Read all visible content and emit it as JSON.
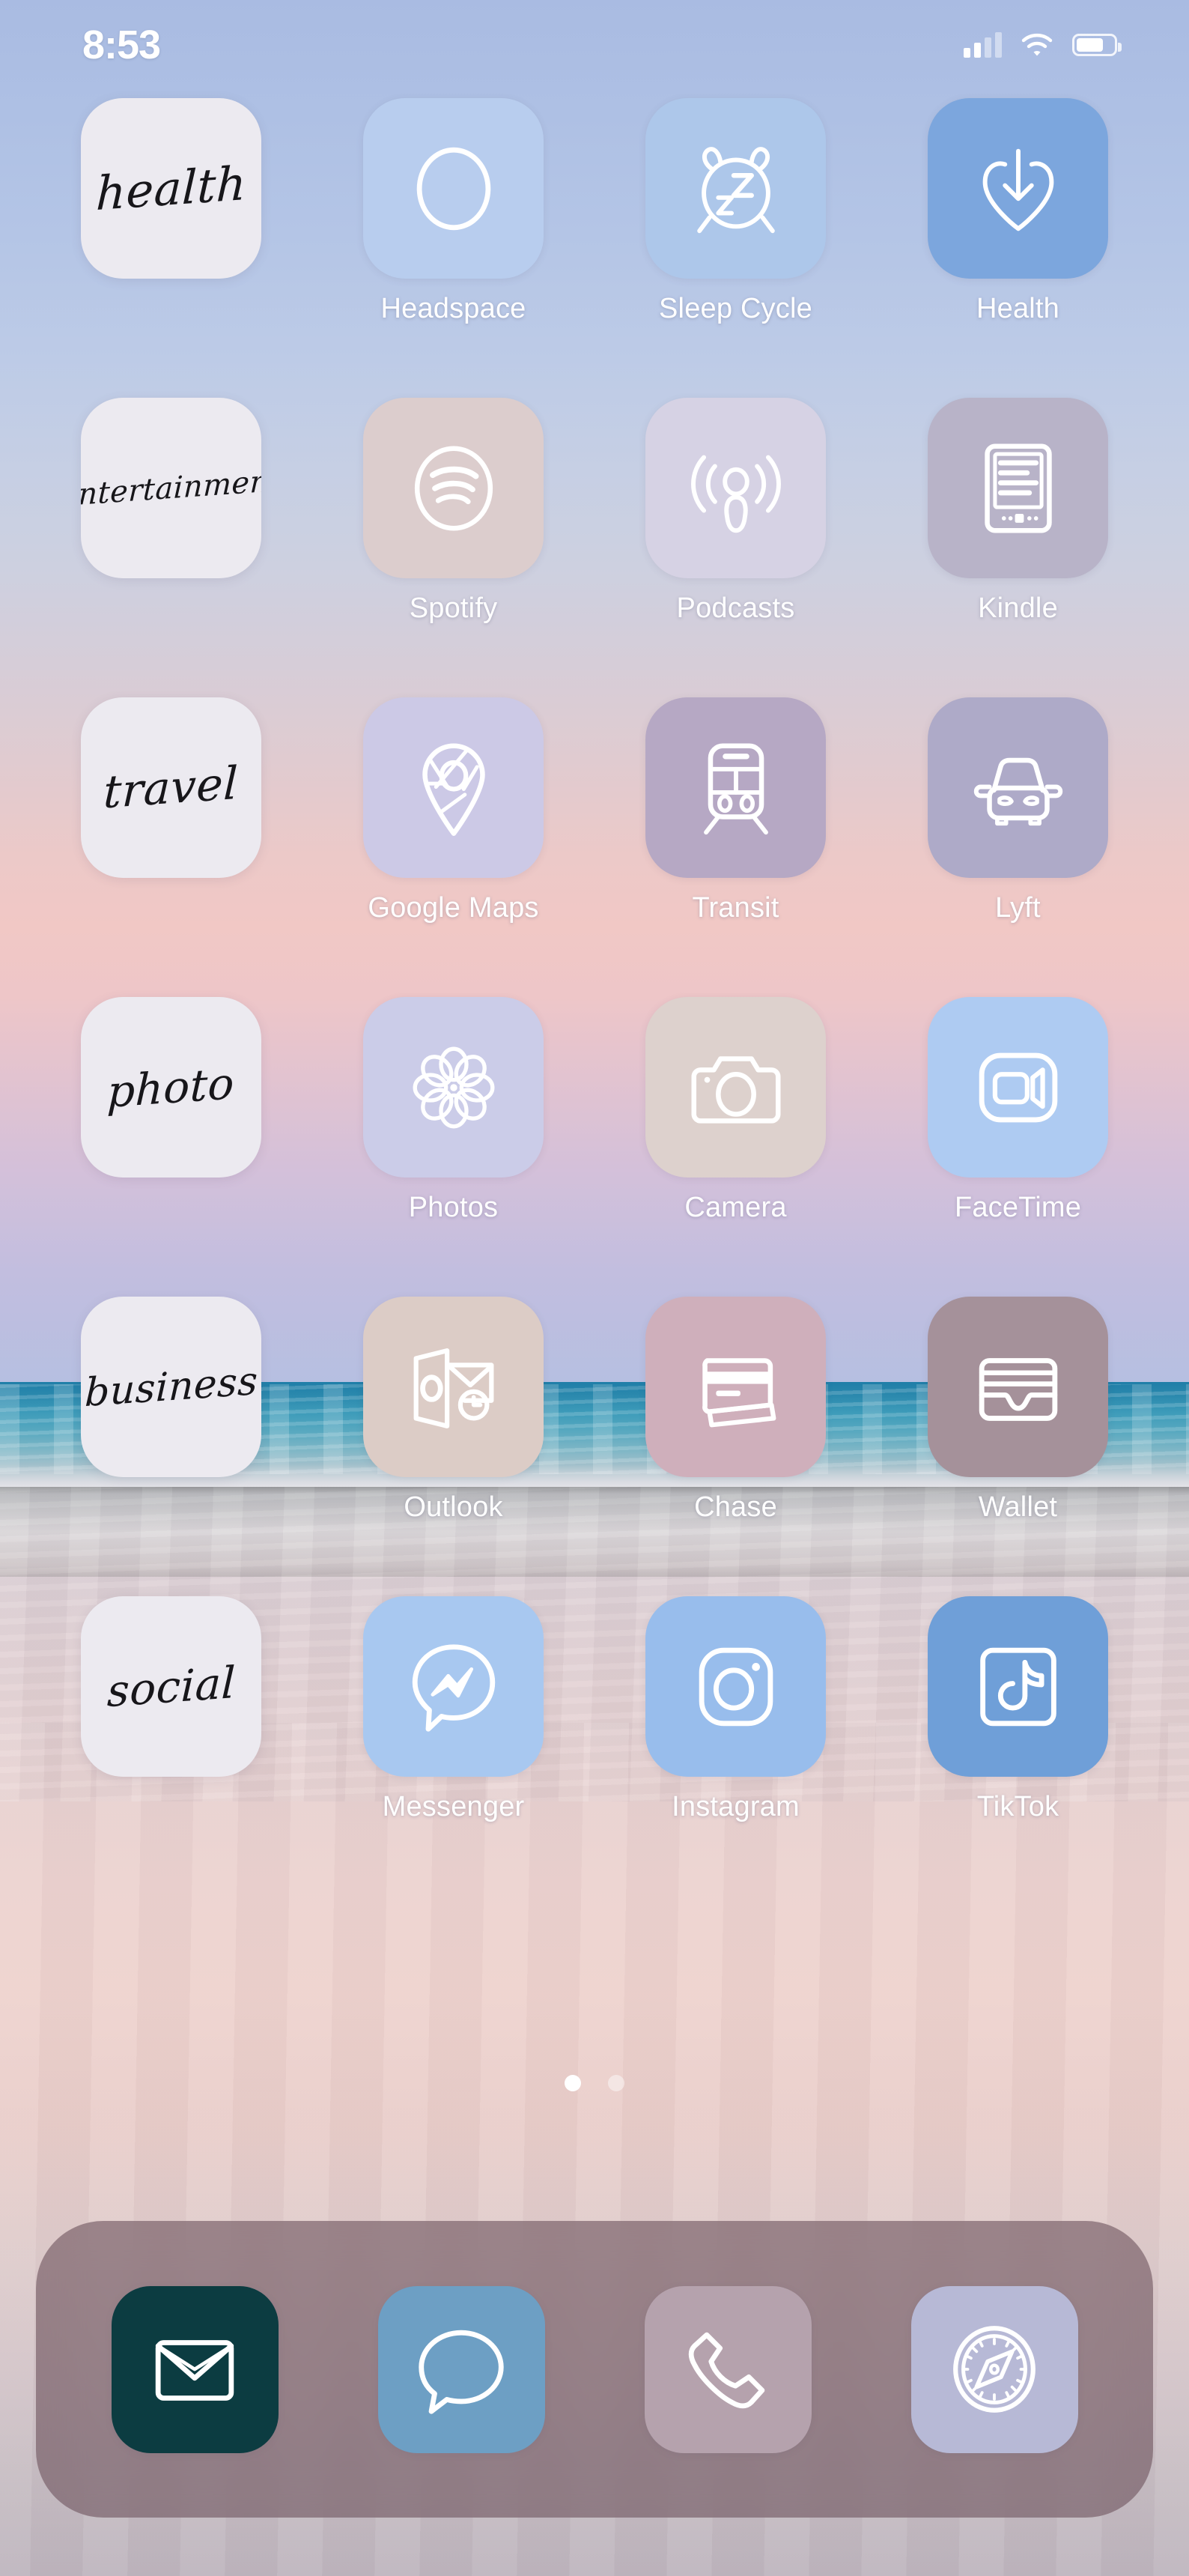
{
  "status_bar": {
    "time": "8:53",
    "cellular_bars_filled": 2,
    "cellular_bars_total": 4,
    "wifi": "wifi-icon",
    "battery_level_percent": 72
  },
  "home_screen": {
    "page_indicator": {
      "total_pages": 2,
      "current_page": 1
    },
    "rows": [
      {
        "folder_label": "health",
        "apps": [
          {
            "name": "Headspace",
            "icon": "circle-outline-icon",
            "tile_color": "#b8cdee"
          },
          {
            "name": "Sleep Cycle",
            "icon": "alarm-clock-sleep-icon",
            "tile_color": "#adc7ea"
          },
          {
            "name": "Health",
            "icon": "heart-download-icon",
            "tile_color": "#7ca6dd"
          }
        ]
      },
      {
        "folder_label": "entertainment",
        "apps": [
          {
            "name": "Spotify",
            "icon": "spotify-waves-icon",
            "tile_color": "#dccdcd"
          },
          {
            "name": "Podcasts",
            "icon": "podcast-antenna-icon",
            "tile_color": "#d6d2e4"
          },
          {
            "name": "Kindle",
            "icon": "ereader-tablet-icon",
            "tile_color": "#b8b3c8"
          }
        ]
      },
      {
        "folder_label": "travel",
        "apps": [
          {
            "name": "Google Maps",
            "icon": "map-pin-icon",
            "tile_color": "#ccc9e6"
          },
          {
            "name": "Transit",
            "icon": "train-front-icon",
            "tile_color": "#b6a8c4"
          },
          {
            "name": "Lyft",
            "icon": "car-front-icon",
            "tile_color": "#aeaac8"
          }
        ]
      },
      {
        "folder_label": "photo",
        "apps": [
          {
            "name": "Photos",
            "icon": "flower-pinwheel-icon",
            "tile_color": "#cbcce8"
          },
          {
            "name": "Camera",
            "icon": "camera-icon",
            "tile_color": "#ddd1cd"
          },
          {
            "name": "FaceTime",
            "icon": "video-camera-icon",
            "tile_color": "#aecbf2"
          }
        ]
      },
      {
        "folder_label": "business",
        "apps": [
          {
            "name": "Outlook",
            "icon": "outlook-envelope-clock-icon",
            "tile_color": "#dcccc6"
          },
          {
            "name": "Chase",
            "icon": "credit-card-icon",
            "tile_color": "#cfafbb"
          },
          {
            "name": "Wallet",
            "icon": "wallet-cards-icon",
            "tile_color": "#a5919a"
          }
        ]
      },
      {
        "folder_label": "social",
        "apps": [
          {
            "name": "Messenger",
            "icon": "messenger-bolt-bubble-icon",
            "tile_color": "#a8c8f0"
          },
          {
            "name": "Instagram",
            "icon": "instagram-camera-icon",
            "tile_color": "#98bdec"
          },
          {
            "name": "TikTok",
            "icon": "tiktok-note-icon",
            "tile_color": "#6f9fd8"
          }
        ]
      }
    ],
    "dock": [
      {
        "name": "Gmail",
        "icon": "envelope-icon",
        "tile_color": "#0c3c41"
      },
      {
        "name": "Messages",
        "icon": "speech-bubble-icon",
        "tile_color": "#6d9fc4"
      },
      {
        "name": "Phone",
        "icon": "phone-handset-icon",
        "tile_color": "#b5a2ad"
      },
      {
        "name": "Safari",
        "icon": "compass-icon",
        "tile_color": "#b7b9d6"
      }
    ]
  }
}
